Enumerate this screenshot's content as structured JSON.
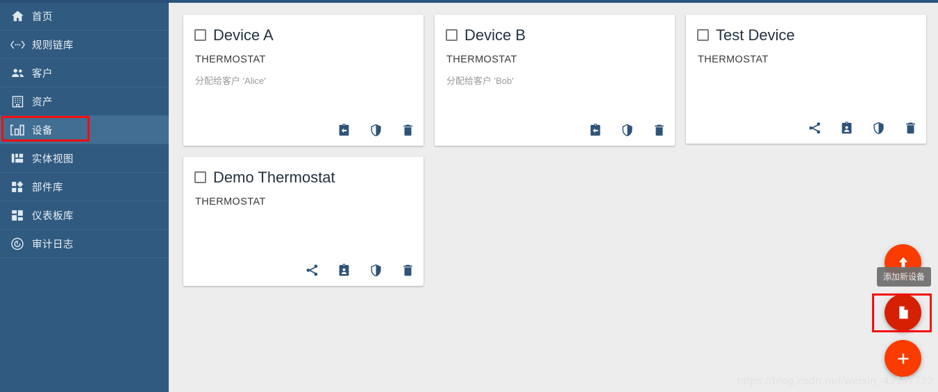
{
  "sidebar": {
    "items": [
      {
        "label": "首页",
        "icon": "home-icon",
        "active": false
      },
      {
        "label": "规则链库",
        "icon": "rulechain-icon",
        "active": false
      },
      {
        "label": "客户",
        "icon": "customers-icon",
        "active": false
      },
      {
        "label": "资产",
        "icon": "assets-icon",
        "active": false
      },
      {
        "label": "设备",
        "icon": "devices-icon",
        "active": true
      },
      {
        "label": "实体视图",
        "icon": "entityview-icon",
        "active": false
      },
      {
        "label": "部件库",
        "icon": "widgets-icon",
        "active": false
      },
      {
        "label": "仪表板库",
        "icon": "dashboards-icon",
        "active": false
      },
      {
        "label": "审计日志",
        "icon": "auditlog-icon",
        "active": false
      }
    ]
  },
  "main": {
    "cards": [
      {
        "title": "Device A",
        "type": "THERMOSTAT",
        "assignment": "分配给客户 'Alice'",
        "actions": [
          "unassign-icon",
          "shield-icon",
          "delete-icon"
        ]
      },
      {
        "title": "Device B",
        "type": "THERMOSTAT",
        "assignment": "分配给客户 'Bob'",
        "actions": [
          "unassign-icon",
          "shield-icon",
          "delete-icon"
        ]
      },
      {
        "title": "Test Device",
        "type": "THERMOSTAT",
        "assignment": "",
        "actions": [
          "share-icon",
          "assign-icon",
          "shield-icon",
          "delete-icon"
        ]
      },
      {
        "title": "Demo Thermostat",
        "type": "THERMOSTAT",
        "assignment": "",
        "actions": [
          "share-icon",
          "assign-icon",
          "shield-icon",
          "delete-icon"
        ]
      }
    ]
  },
  "fabs": {
    "upload_icon": "upload-icon",
    "file_icon": "file-icon",
    "add_icon": "plus-icon",
    "tooltip": "添加新设备"
  },
  "watermark": "https://blog.csdn.net/weixin_43137722",
  "colors": {
    "sidebar_bg": "#305a80",
    "sidebar_active": "#426e93",
    "content_bg": "#ededed",
    "card_bg": "#ffffff",
    "icon_blue": "#2e5378",
    "fab_orange": "#fa3c00",
    "fab_pressed": "#d62003",
    "annotation_red": "#f60d0d"
  }
}
